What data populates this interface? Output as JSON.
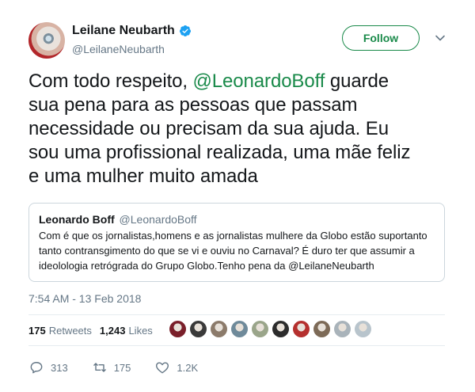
{
  "author": {
    "display_name": "Leilane Neubarth",
    "handle": "@LeilaneNeubarth",
    "verified": true
  },
  "follow_button": {
    "label": "Follow"
  },
  "tweet": {
    "lines": [
      [
        "Com todo respeito, ",
        "@LeonardoBoff",
        " guarde"
      ],
      "sua pena para as pessoas que passam",
      "necessidade ou precisam da sua ajuda. Eu",
      "sou uma profissional realizada, uma mãe feliz",
      "e uma mulher muito amada"
    ]
  },
  "quoted_tweet": {
    "name": "Leonardo Boff",
    "handle": "@LeonardoBoff",
    "lines": [
      "Com é que os jornalistas,homens e as jornalistas mulhere da Globo estão suportanto",
      "tanto contransgimento do que se vi e ouviu no Carnaval? É duro ter que assumir a",
      "ideolologia retrógrada do Grupo Globo.Tenho pena da @LeilaneNeubarth"
    ]
  },
  "timestamp": "7:54 AM - 13 Feb 2018",
  "stats": {
    "retweets_count": "175",
    "retweets_label": "Retweets",
    "likes_count": "1,243",
    "likes_label": "Likes"
  },
  "likers": [
    {
      "color": "#7a1f2a"
    },
    {
      "color": "#3a3a3a"
    },
    {
      "color": "#8c7b6b"
    },
    {
      "color": "#6f8a9a"
    },
    {
      "color": "#9aa58a"
    },
    {
      "color": "#2c2c2c"
    },
    {
      "color": "#b5302e"
    },
    {
      "color": "#7d6a57"
    },
    {
      "color": "#a9b3ba"
    },
    {
      "color": "#b8c4cc"
    }
  ],
  "actions": {
    "reply_count": "313",
    "retweet_count": "175",
    "like_count": "1.2K"
  },
  "colors": {
    "accent": "#1a8a4a",
    "verified": "#1da1f2",
    "muted": "#657786",
    "text": "#14171a"
  }
}
